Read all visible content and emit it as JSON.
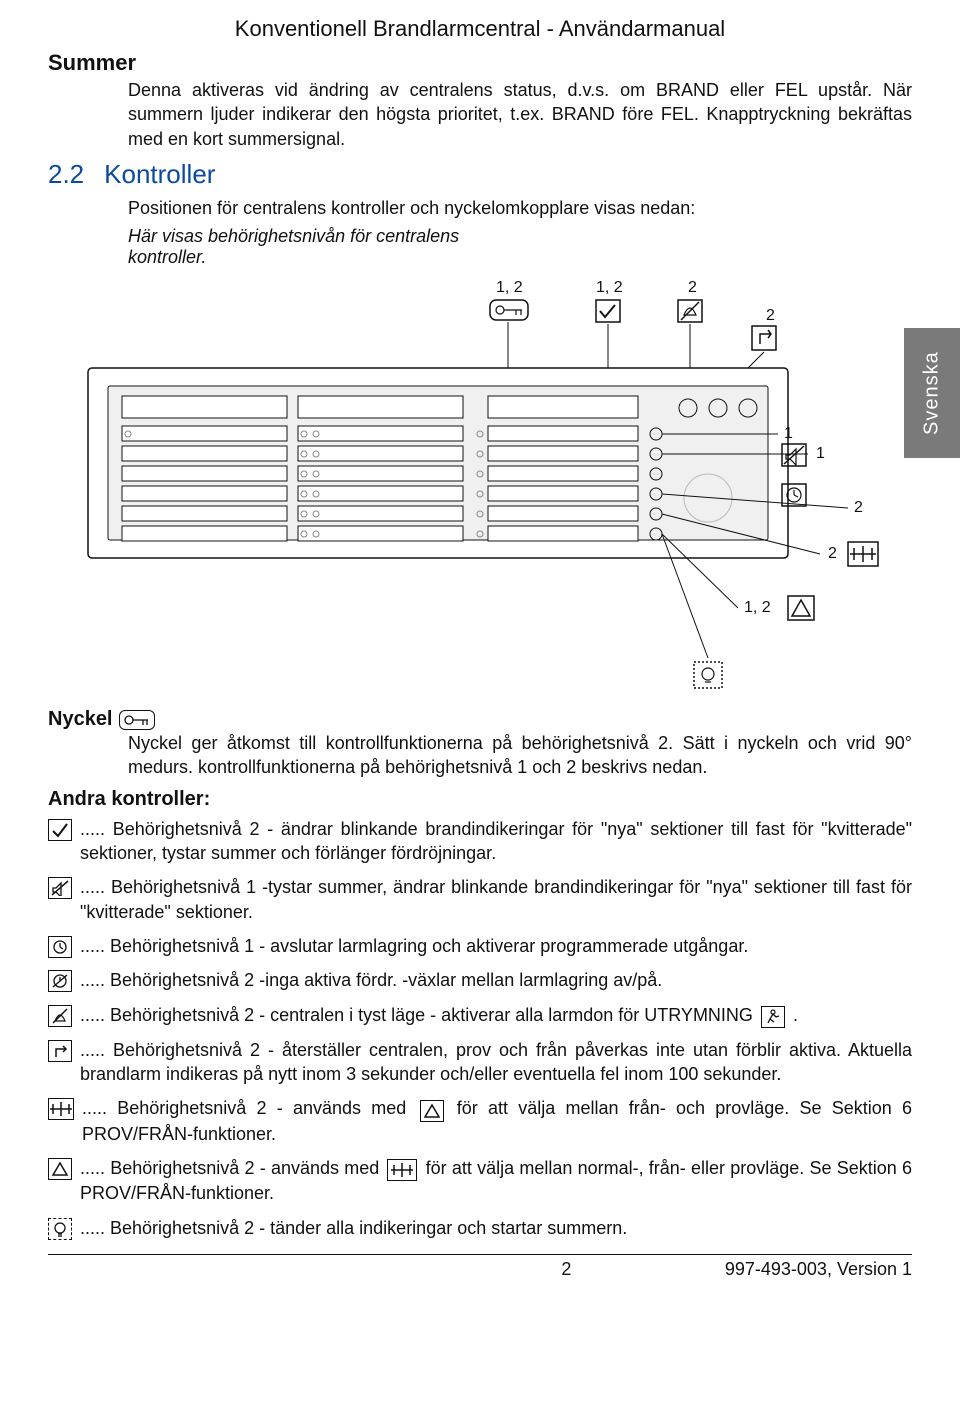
{
  "header": {
    "title": "Konventionell Brandlarmcentral - Användarmanual"
  },
  "summer": {
    "heading": "Summer",
    "body": "Denna aktiveras vid ändring av centralens status, d.v.s. om BRAND eller FEL upstår. När summern ljuder indikerar den högsta prioritet, t.ex. BRAND före FEL. Knapptryckning bekräftas med en kort summersignal."
  },
  "sec22": {
    "num": "2.2",
    "title": "Kontroller",
    "intro": "Positionen för centralens kontroller och nyckelomkopplare visas nedan:",
    "caption": "Här visas behörighetsnivån för centralens kontroller."
  },
  "figure": {
    "labels": {
      "l12a": "1, 2",
      "l12b": "1, 2",
      "l2a": "2",
      "l2b": "2",
      "l1a": "1",
      "l1b": "1",
      "l2c": "2",
      "l2d": "2",
      "l12c": "1, 2"
    }
  },
  "tab": {
    "label": "Svenska"
  },
  "nyckel": {
    "heading": "Nyckel",
    "body": "Nyckel ger åtkomst till kontrollfunktionerna på behörighetsnivå 2. Sätt i nyckeln och vrid 90° medurs. kontrollfunktionerna på behörighetsnivå 1 och 2 beskrivs nedan."
  },
  "andra": {
    "heading": "Andra kontroller:",
    "items": [
      "..... Behörighetsnivå 2 - ändrar blinkande brandindikeringar för \"nya\" sektioner till fast för \"kvitterade\" sektioner, tystar summer och förlänger fördröjningar.",
      "..... Behörighetsnivå 1 -tystar summer, ändrar blinkande brandindikeringar för \"nya\" sektioner till fast för \"kvitterade\" sektioner.",
      "..... Behörighetsnivå 1 - avslutar larmlagring och aktiverar programmerade utgångar.",
      "..... Behörighetsnivå 2 -inga aktiva fördr. -växlar mellan larmlagring av/på.",
      "..... Behörighetsnivå 2 - centralen i tyst läge - aktiverar alla larmdon för ",
      "..... Behörighetsnivå 2 - återställer centralen, prov och från påverkas inte utan förblir aktiva. Aktuella brandlarm indikeras på nytt inom 3 sekunder och/eller eventuella fel inom 100 sekunder.",
      "..... Behörighetsnivå 2 - används med ",
      "..... Behörighetsnivå 2 - används med ",
      "..... Behörighetsnivå 2 - tänder alla indikeringar och startar summern."
    ],
    "item4_tail": "UTRYMNING ",
    "item4_period": ".",
    "item6_tail": " för att välja mellan från- och provläge. Se Sektion 6 PROV/FRÅN-funktioner.",
    "item7_tail": " för att välja mellan normal-, från- eller provläge. Se Sektion 6 PROV/FRÅN-funktioner."
  },
  "footer": {
    "page": "2",
    "doc": "997-493-003, Version 1"
  }
}
